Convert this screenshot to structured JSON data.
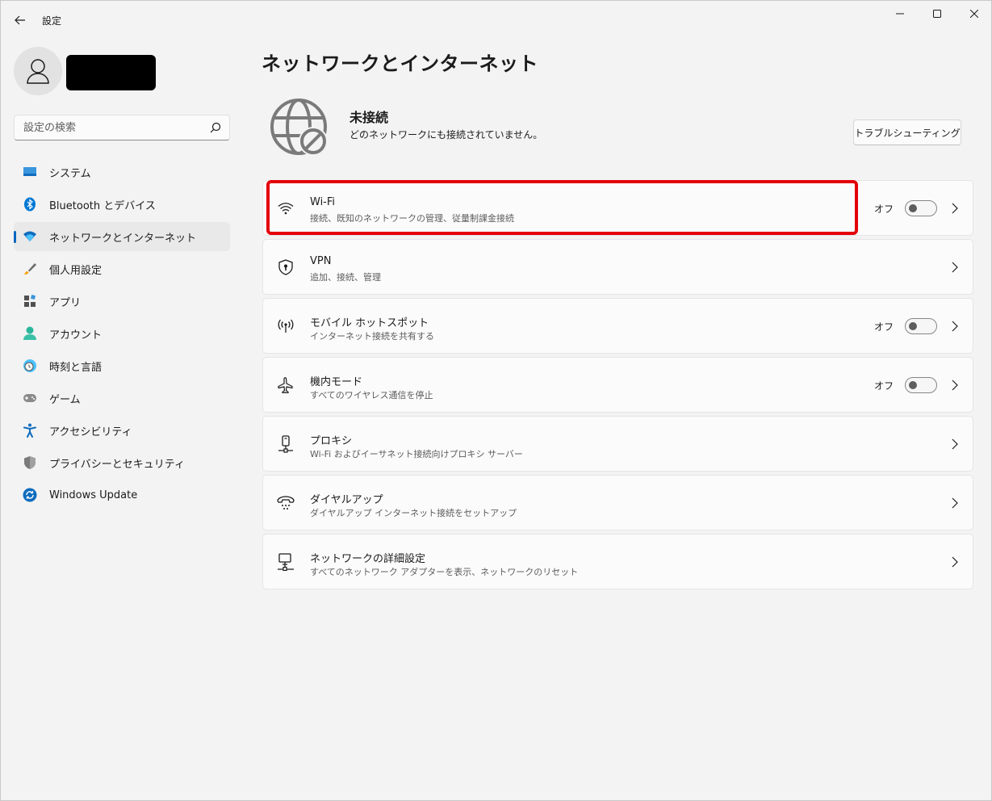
{
  "window": {
    "title": "設定",
    "controls": [
      "minimize-icon",
      "maximize-icon",
      "close-icon"
    ]
  },
  "sidebar": {
    "search_placeholder": "設定の検索",
    "items": [
      {
        "label": "システム",
        "icon": "system-icon",
        "selected": false
      },
      {
        "label": "Bluetooth とデバイス",
        "icon": "bluetooth-icon",
        "selected": false
      },
      {
        "label": "ネットワークとインターネット",
        "icon": "network-icon",
        "selected": true
      },
      {
        "label": "個人用設定",
        "icon": "brush-icon",
        "selected": false
      },
      {
        "label": "アプリ",
        "icon": "apps-icon",
        "selected": false
      },
      {
        "label": "アカウント",
        "icon": "account-icon",
        "selected": false
      },
      {
        "label": "時刻と言語",
        "icon": "time-language-icon",
        "selected": false
      },
      {
        "label": "ゲーム",
        "icon": "gamepad-icon",
        "selected": false
      },
      {
        "label": "アクセシビリティ",
        "icon": "accessibility-icon",
        "selected": false
      },
      {
        "label": "プライバシーとセキュリティ",
        "icon": "shield-icon",
        "selected": false
      },
      {
        "label": "Windows Update",
        "icon": "update-icon",
        "selected": false
      }
    ]
  },
  "main": {
    "title": "ネットワークとインターネット",
    "status": {
      "title": "未接続",
      "description": "どのネットワークにも接続されていません。",
      "troubleshoot_label": "トラブルシューティング"
    },
    "cards": [
      {
        "title": "Wi-Fi",
        "subtitle": "接続、既知のネットワークの管理、従量制課金接続",
        "icon": "wifi-icon",
        "state": "オフ",
        "toggle": false
      },
      {
        "title": "VPN",
        "subtitle": "追加、接続、管理",
        "icon": "vpn-shield-icon"
      },
      {
        "title": "モバイル ホットスポット",
        "subtitle": "インターネット接続を共有する",
        "icon": "hotspot-icon",
        "state": "オフ",
        "toggle": false
      },
      {
        "title": "機内モード",
        "subtitle": "すべてのワイヤレス通信を停止",
        "icon": "airplane-icon",
        "state": "オフ",
        "toggle": false
      },
      {
        "title": "プロキシ",
        "subtitle": "Wi-Fi およびイーサネット接続向けプロキシ サーバー",
        "icon": "proxy-icon"
      },
      {
        "title": "ダイヤルアップ",
        "subtitle": "ダイヤルアップ インターネット接続をセットアップ",
        "icon": "dialup-icon"
      },
      {
        "title": "ネットワークの詳細設定",
        "subtitle": "すべてのネットワーク アダプターを表示、ネットワークのリセット",
        "icon": "advanced-network-icon"
      }
    ]
  },
  "colors": {
    "accent": "#0067c0",
    "highlight_border": "#e3000b",
    "background": "#f3f3f3"
  }
}
